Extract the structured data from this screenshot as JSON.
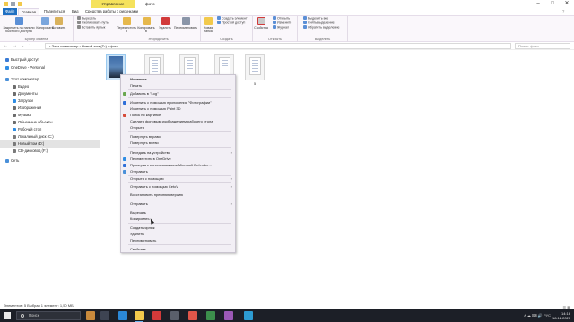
{
  "window": {
    "manage_tab": "Управление",
    "title": "фото",
    "minimize": "–",
    "maximize": "□",
    "close": "✕"
  },
  "tabs": [
    "Файл",
    "Главная",
    "Поделиться",
    "Вид",
    "Средства работы с рисунками"
  ],
  "ribbon": {
    "clipboard": {
      "label": "Буфер обмена",
      "pin": "Закрепить на панели быстрого доступа",
      "copy": "Копировать",
      "paste": "Вставить",
      "cut": "Вырезать",
      "copy_path": "Скопировать путь",
      "paste_shortcut": "Вставить ярлык"
    },
    "organize": {
      "label": "Упорядочить",
      "move_to": "Переместить в",
      "copy_to": "Копировать в",
      "delete": "Удалить",
      "rename": "Переименовать"
    },
    "create": {
      "label": "Создать",
      "new_folder": "Новая папка",
      "new_item": "Создать элемент",
      "easy_access": "Простой доступ"
    },
    "open": {
      "label": "Открыть",
      "properties": "Свойства",
      "open": "Открыть",
      "edit": "Изменить",
      "history": "Журнал"
    },
    "select": {
      "label": "Выделить",
      "select_all": "Выделить все",
      "select_none": "Снять выделение",
      "invert": "Обратить выделение"
    }
  },
  "address": {
    "path": "›  Этот компьютер  ›  Новый том (D:)  ›  фото",
    "search_placeholder": "Поиск: фото"
  },
  "nav": {
    "items": [
      {
        "label": "Быстрый доступ",
        "color": "#3a7bd5"
      },
      {
        "label": "OneDrive - Personal",
        "color": "#2f8de4"
      },
      {
        "label": "Этот компьютер",
        "color": "#4a90d9"
      },
      {
        "label": "Видео",
        "color": "#6d6d6d"
      },
      {
        "label": "Документы",
        "color": "#6d6d6d"
      },
      {
        "label": "Загрузки",
        "color": "#2f8de4"
      },
      {
        "label": "Изображения",
        "color": "#6d6d6d"
      },
      {
        "label": "Музыка",
        "color": "#6d6d6d"
      },
      {
        "label": "Объемные объекты",
        "color": "#6d6d6d"
      },
      {
        "label": "Рабочий стол",
        "color": "#2f8de4"
      },
      {
        "label": "Локальный диск (C:)",
        "color": "#7a7a7a"
      },
      {
        "label": "Новый том (D:)",
        "color": "#7a7a7a"
      },
      {
        "label": "CD-дисковод (F:)",
        "color": "#7a7a7a"
      },
      {
        "label": "Сеть",
        "color": "#4a90d9"
      }
    ]
  },
  "files": {
    "last_caption": "5"
  },
  "context_menu": {
    "items": [
      {
        "label": "Изменить",
        "bold": true
      },
      {
        "label": "Печать"
      },
      {
        "label": "Добавить в \"Log\"",
        "icon": "#6aa84f"
      },
      {
        "label": "Изменить с помощью приложения \"Фотографии\"",
        "icon": "#2f6fd8"
      },
      {
        "label": "Изменить с помощью Paint 3D"
      },
      {
        "label": "Поиск по картинке",
        "icon": "#d64b3a"
      },
      {
        "label": "Сделать фоновым изображением рабочего стола"
      },
      {
        "label": "Открыть"
      },
      {
        "label": "Повернуть вправо"
      },
      {
        "label": "Повернуть влево"
      },
      {
        "label": "Передать на устройство",
        "arrow": true
      },
      {
        "label": "Переместить в OneDrive",
        "icon": "#2f8de4"
      },
      {
        "label": "Проверка с использованием Microsoft Defender...",
        "icon": "#2f6fd8"
      },
      {
        "label": "Отправить",
        "icon": "#4a90d9"
      },
      {
        "label": "Открыть с помощью",
        "arrow": true
      },
      {
        "label": "Отправить с помощью CetoV",
        "arrow": true
      },
      {
        "label": "Восстановить прежнюю версию"
      },
      {
        "label": "Отправить",
        "arrow": true
      },
      {
        "label": "Вырезать"
      },
      {
        "label": "Копировать"
      },
      {
        "label": "Создать ярлык"
      },
      {
        "label": "Удалить"
      },
      {
        "label": "Переименовать"
      },
      {
        "label": "Свойства"
      }
    ]
  },
  "status": {
    "text": "Элементов: 5    Выбран 1 элемент: 1,50 МБ"
  },
  "taskbar": {
    "search_placeholder": "Поиск",
    "time": "14:16",
    "date": "18.12.2021",
    "tray": "∧  ☁  ⌨  🔊  РУС"
  }
}
